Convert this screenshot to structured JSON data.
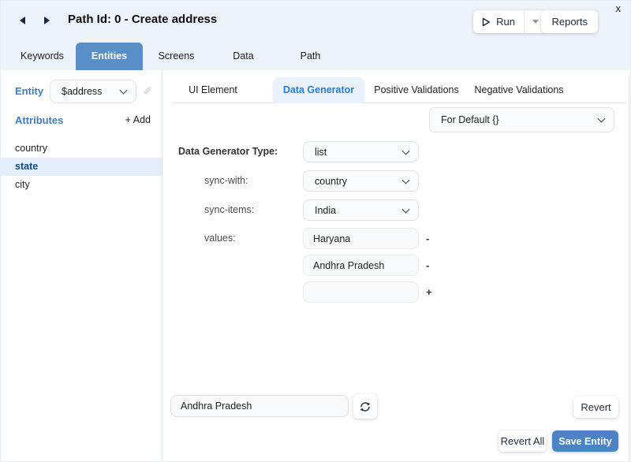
{
  "window": {
    "title": "Path Id: 0 - Create address",
    "close_label": "x",
    "run_button": "Run",
    "reports_button": "Reports"
  },
  "main_tabs": [
    {
      "label": "Keywords",
      "active": false
    },
    {
      "label": "Entities",
      "active": true
    },
    {
      "label": "Screens",
      "active": false
    },
    {
      "label": "Data",
      "active": false
    },
    {
      "label": "Path",
      "active": false
    }
  ],
  "sidebar": {
    "entity_label": "Entity",
    "entity_value": "$address",
    "attributes_label": "Attributes",
    "add_button": "+ Add",
    "attributes": [
      {
        "name": "country",
        "selected": false
      },
      {
        "name": "state",
        "selected": true
      },
      {
        "name": "city",
        "selected": false
      }
    ]
  },
  "subtabs": [
    {
      "label": "UI Element",
      "active": false
    },
    {
      "label": "Data Generator",
      "active": true
    },
    {
      "label": "Positive Validations",
      "active": false
    },
    {
      "label": "Negative Validations",
      "active": false
    }
  ],
  "generator": {
    "scope_value": "For Default {}",
    "type_label": "Data Generator Type:",
    "type_value": "list",
    "sync_with_label": "sync-with:",
    "sync_with_value": "country",
    "sync_items_label": "sync-items:",
    "sync_items_value": "India",
    "values_label": "values:",
    "values": [
      {
        "value": "Haryana",
        "action": "-"
      },
      {
        "value": "Andhra Pradesh",
        "action": "-"
      },
      {
        "value": "",
        "action": "+"
      }
    ],
    "preview_value": "Andhra Pradesh",
    "revert_button": "Revert"
  },
  "footer": {
    "revert_all_button": "Revert All",
    "save_button": "Save Entity"
  },
  "colors": {
    "header_bg": "#edf3fa",
    "active_tab_bg": "#5a8ec6",
    "subtab_active_bg": "#e9f2fd",
    "subtab_active_text": "#2a7cd4",
    "selected_row_bg": "#e4eefa",
    "selected_row_text": "#13497f",
    "label_blue": "#3d7ec1",
    "save_button_bg": "#4c83c4"
  }
}
